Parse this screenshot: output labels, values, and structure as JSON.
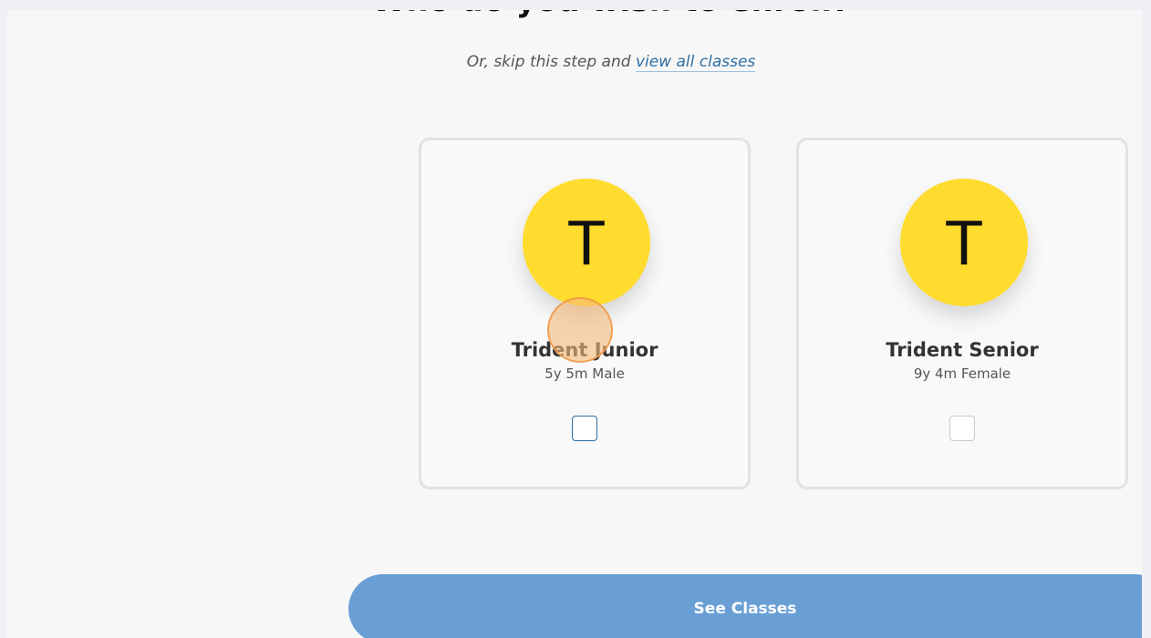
{
  "page": {
    "heading": "Who do you wish to enroll?",
    "skip_prefix": "Or, skip this step and ",
    "skip_link": "view all classes"
  },
  "students": [
    {
      "initial": "T",
      "name": "Trident Junior",
      "details": "5y 5m Male",
      "checked": false
    },
    {
      "initial": "T",
      "name": "Trident Senior",
      "details": "9y 4m Female",
      "checked": false
    }
  ],
  "cta": {
    "label": "See Classes"
  },
  "colors": {
    "avatar": "#ffdc2e",
    "button": "#6a9fd6",
    "link": "#2f6fa3"
  }
}
